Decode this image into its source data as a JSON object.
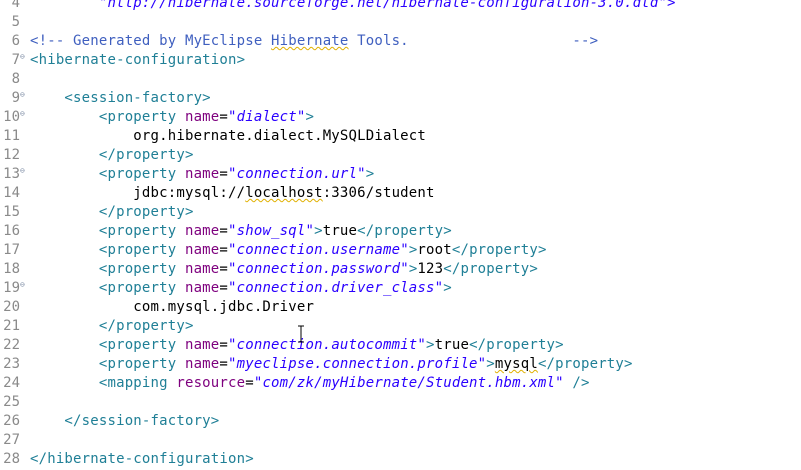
{
  "editor": {
    "lines": [
      {
        "num": "4",
        "fold": "",
        "parts": [
          {
            "cls": "v",
            "text": "        \"http://hibernate.sourceforge.net/hibernate-configuration-3.0.dtd\">"
          }
        ]
      },
      {
        "num": "5",
        "fold": "",
        "parts": []
      },
      {
        "num": "6",
        "fold": "",
        "parts": [
          {
            "cls": "c",
            "text": "<!-- Generated by MyEclipse "
          },
          {
            "cls": "c sq",
            "text": "Hibernate"
          },
          {
            "cls": "c",
            "text": " Tools.                   -->"
          }
        ]
      },
      {
        "num": "7",
        "fold": "⊖",
        "parts": [
          {
            "cls": "t",
            "text": "<hibernate-configuration>"
          }
        ]
      },
      {
        "num": "8",
        "fold": "",
        "parts": []
      },
      {
        "num": "9",
        "fold": "⊖",
        "parts": [
          {
            "cls": "t",
            "text": "    <session-factory>"
          }
        ]
      },
      {
        "num": "10",
        "fold": "⊖",
        "parts": [
          {
            "cls": "t",
            "text": "        <property "
          },
          {
            "cls": "an",
            "text": "name"
          },
          {
            "cls": "tx",
            "text": "="
          },
          {
            "cls": "v",
            "text": "\"dialect\""
          },
          {
            "cls": "t",
            "text": ">"
          }
        ]
      },
      {
        "num": "11",
        "fold": "",
        "parts": [
          {
            "cls": "tx",
            "text": "            org.hibernate.dialect.MySQLDialect"
          }
        ]
      },
      {
        "num": "12",
        "fold": "",
        "parts": [
          {
            "cls": "t",
            "text": "        </property>"
          }
        ]
      },
      {
        "num": "13",
        "fold": "⊖",
        "parts": [
          {
            "cls": "t",
            "text": "        <property "
          },
          {
            "cls": "an",
            "text": "name"
          },
          {
            "cls": "tx",
            "text": "="
          },
          {
            "cls": "v",
            "text": "\"connection.url\""
          },
          {
            "cls": "t",
            "text": ">"
          }
        ]
      },
      {
        "num": "14",
        "fold": "",
        "parts": [
          {
            "cls": "tx",
            "text": "            jdbc:mysql://"
          },
          {
            "cls": "tx sq",
            "text": "localhost"
          },
          {
            "cls": "tx",
            "text": ":3306/student"
          }
        ]
      },
      {
        "num": "15",
        "fold": "",
        "parts": [
          {
            "cls": "t",
            "text": "        </property>"
          }
        ]
      },
      {
        "num": "16",
        "fold": "",
        "parts": [
          {
            "cls": "t",
            "text": "        <property "
          },
          {
            "cls": "an",
            "text": "name"
          },
          {
            "cls": "tx",
            "text": "="
          },
          {
            "cls": "v",
            "text": "\"show_sql\""
          },
          {
            "cls": "t",
            "text": ">"
          },
          {
            "cls": "tx",
            "text": "true"
          },
          {
            "cls": "t",
            "text": "</property>"
          }
        ]
      },
      {
        "num": "17",
        "fold": "",
        "parts": [
          {
            "cls": "t",
            "text": "        <property "
          },
          {
            "cls": "an",
            "text": "name"
          },
          {
            "cls": "tx",
            "text": "="
          },
          {
            "cls": "v",
            "text": "\"connection.username\""
          },
          {
            "cls": "t",
            "text": ">"
          },
          {
            "cls": "tx",
            "text": "root"
          },
          {
            "cls": "t",
            "text": "</property>"
          }
        ]
      },
      {
        "num": "18",
        "fold": "",
        "parts": [
          {
            "cls": "t",
            "text": "        <property "
          },
          {
            "cls": "an",
            "text": "name"
          },
          {
            "cls": "tx",
            "text": "="
          },
          {
            "cls": "v",
            "text": "\"connection.password\""
          },
          {
            "cls": "t",
            "text": ">"
          },
          {
            "cls": "tx",
            "text": "123"
          },
          {
            "cls": "t",
            "text": "</property>"
          }
        ]
      },
      {
        "num": "19",
        "fold": "⊖",
        "parts": [
          {
            "cls": "t",
            "text": "        <property "
          },
          {
            "cls": "an",
            "text": "name"
          },
          {
            "cls": "tx",
            "text": "="
          },
          {
            "cls": "v",
            "text": "\"connection.driver_class\""
          },
          {
            "cls": "t",
            "text": ">"
          }
        ]
      },
      {
        "num": "20",
        "fold": "",
        "parts": [
          {
            "cls": "tx",
            "text": "            com.mysql.jdbc.Driver"
          }
        ]
      },
      {
        "num": "21",
        "fold": "",
        "parts": [
          {
            "cls": "t",
            "text": "        </property>"
          }
        ]
      },
      {
        "num": "22",
        "fold": "",
        "parts": [
          {
            "cls": "t",
            "text": "        <property "
          },
          {
            "cls": "an",
            "text": "name"
          },
          {
            "cls": "tx",
            "text": "="
          },
          {
            "cls": "v",
            "text": "\"connection.autocommit\""
          },
          {
            "cls": "t",
            "text": ">"
          },
          {
            "cls": "tx",
            "text": "true"
          },
          {
            "cls": "t",
            "text": "</property>"
          }
        ]
      },
      {
        "num": "23",
        "fold": "",
        "parts": [
          {
            "cls": "t",
            "text": "        <property "
          },
          {
            "cls": "an",
            "text": "name"
          },
          {
            "cls": "tx",
            "text": "="
          },
          {
            "cls": "v",
            "text": "\"myeclipse.connection.profile\""
          },
          {
            "cls": "t",
            "text": ">"
          },
          {
            "cls": "tx sq",
            "text": "mysql"
          },
          {
            "cls": "t",
            "text": "</property>"
          }
        ]
      },
      {
        "num": "24",
        "fold": "",
        "parts": [
          {
            "cls": "t",
            "text": "        <mapping "
          },
          {
            "cls": "an",
            "text": "resource"
          },
          {
            "cls": "tx",
            "text": "="
          },
          {
            "cls": "v",
            "text": "\"com/zk/myHibernate/Student.hbm.xml\""
          },
          {
            "cls": "t",
            "text": " />"
          }
        ]
      },
      {
        "num": "25",
        "fold": "",
        "parts": []
      },
      {
        "num": "26",
        "fold": "",
        "parts": [
          {
            "cls": "t",
            "text": "    </session-factory>"
          }
        ]
      },
      {
        "num": "27",
        "fold": "",
        "parts": []
      },
      {
        "num": "28",
        "fold": "",
        "parts": [
          {
            "cls": "t",
            "text": "</hibernate-configuration>"
          }
        ]
      }
    ]
  },
  "colors": {
    "tag": "#1f7f96",
    "attribute": "#7e007e",
    "value": "#2a00ff",
    "comment": "#3f5fbf",
    "line_number": "#8a8a8a"
  }
}
